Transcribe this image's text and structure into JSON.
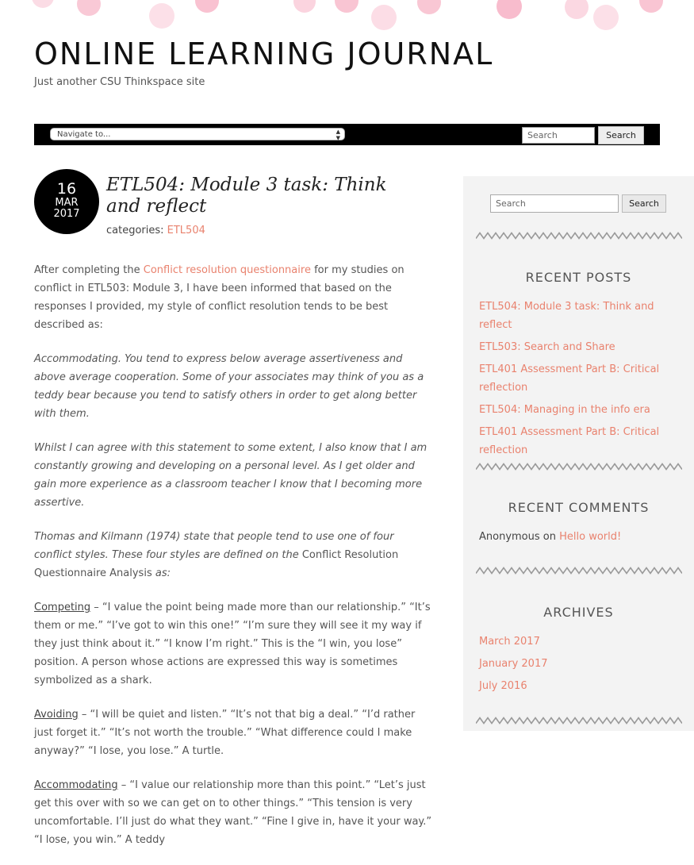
{
  "site": {
    "title": "ONLINE LEARNING JOURNAL",
    "tagline": "Just another CSU Thinkspace site"
  },
  "nav": {
    "select_value": "Navigate to...",
    "search_placeholder": "Search",
    "search_button": "Search"
  },
  "post": {
    "date_day": "16",
    "date_month": "MAR",
    "date_year": "2017",
    "title": "ETL504: Module 3 task: Think and reflect",
    "categories_label": "categories: ",
    "category": "ETL504",
    "p1_before": "After completing the ",
    "p1_link": "Conflict resolution questionnaire",
    "p1_after": " for my studies on conflict in ETL503: Module 3, I have been informed that based on the responses I provided, my style of conflict resolution tends to be best described as:",
    "p2": "Accommodating. You tend to express below average assertiveness and above average cooperation. Some of your associates may think of you as a teddy bear because you tend to satisfy others in order to get along better with them.",
    "p3": "Whilst I can agree with this statement to some extent, I also know that I am constantly growing and developing on a personal level. As I get older and gain more experience as a classroom teacher I know that I becoming more assertive.",
    "p4_a": "Thomas and Kilmann (1974) state that people tend to use one of four conflict styles. These four styles are defined on the ",
    "p4_b": "Conflict Resolution Questionnaire Analysis",
    "p4_c": " as:",
    "s1_term": "Competing",
    "s1_text": " – “I value the point being made more than our relationship.” “It’s them or me.” “I’ve got to win this one!” “I’m sure they will see it my way if they just think about it.” “I know I’m right.” This is the “I win, you lose” position. A person whose actions are expressed this way is sometimes symbolized as a shark.",
    "s2_term": "Avoiding",
    "s2_text": " – “I will be quiet and listen.” “It’s not that big a deal.” “I’d rather just forget it.” “It’s not worth the trouble.” “What difference could I make anyway?” “I lose, you lose.” A turtle.",
    "s3_term": "Accommodating",
    "s3_text": " – “I value our relationship more than this point.” “Let’s just get this over with so we can get on to other things.” “This tension is very uncomfortable. I’ll just do what they want.” “Fine I give in, have it your way.” “I lose, you win.” A teddy"
  },
  "sidebar": {
    "search_placeholder": "Search",
    "search_button": "Search",
    "recent_posts_title": "RECENT POSTS",
    "recent_posts": [
      "ETL504: Module 3 task: Think and reflect",
      "ETL503: Search and Share",
      "ETL401 Assessment Part B: Critical reflection",
      "ETL504: Managing in the info era",
      "ETL401 Assessment Part B: Critical reflection"
    ],
    "recent_comments_title": "RECENT COMMENTS",
    "comment_author": "Anonymous",
    "comment_on": " on ",
    "comment_post": "Hello world!",
    "archives_title": "ARCHIVES",
    "archives": [
      "March 2017",
      "January 2017",
      "July 2016"
    ]
  },
  "colors": {
    "link": "#e9826e",
    "dot_pink": "#f7c6d3",
    "sidebar_bg": "#f3f3f3"
  }
}
